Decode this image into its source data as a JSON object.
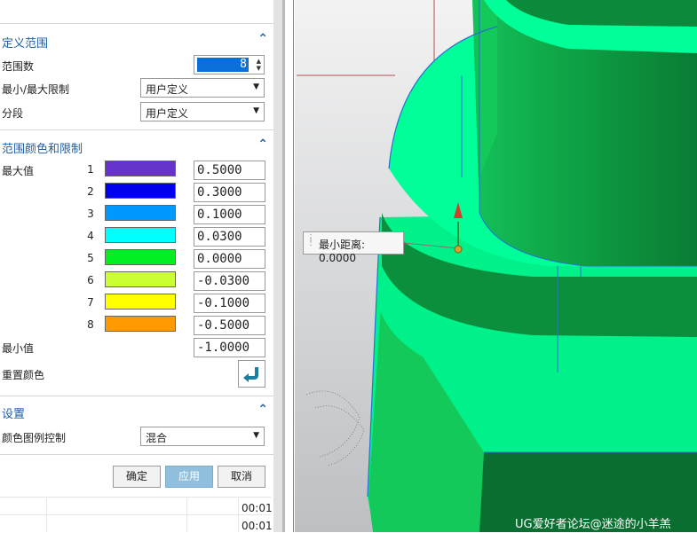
{
  "sections": {
    "range_definition": {
      "title": "定义范围",
      "num_ranges_label": "范围数",
      "num_ranges_value": "8",
      "minmax_label": "最小/最大限制",
      "minmax_value": "用户定义",
      "segment_label": "分段",
      "segment_value": "用户定义"
    },
    "range_colors": {
      "title": "范围颜色和限制",
      "max_label": "最大值",
      "min_label": "最小值",
      "min_value": "-1.0000",
      "reset_label": "重置颜色",
      "rows": [
        {
          "index": "1",
          "color": "#6633cc",
          "value": "0.5000"
        },
        {
          "index": "2",
          "color": "#0000ee",
          "value": "0.3000"
        },
        {
          "index": "3",
          "color": "#0099ff",
          "value": "0.1000"
        },
        {
          "index": "4",
          "color": "#00ffff",
          "value": "0.0300"
        },
        {
          "index": "5",
          "color": "#00ee22",
          "value": "0.0000"
        },
        {
          "index": "6",
          "color": "#ccff33",
          "value": "-0.0300"
        },
        {
          "index": "7",
          "color": "#ffff00",
          "value": "-0.1000"
        },
        {
          "index": "8",
          "color": "#ff9900",
          "value": "-0.5000"
        }
      ]
    },
    "settings": {
      "title": "设置",
      "legend_label": "颜色图例控制",
      "legend_value": "混合"
    }
  },
  "buttons": {
    "ok": "确定",
    "apply": "应用",
    "cancel": "取消"
  },
  "table_rows": [
    {
      "time": "00:01"
    },
    {
      "time": "00:01"
    }
  ],
  "viewport": {
    "callout_text": "最小距离: 0.0000",
    "watermark": "UG爱好者论坛@迷途的小羊羔"
  },
  "icons": {
    "collapse": "chevron-up-icon",
    "reset": "reset-arrow-icon",
    "dropdown": "chevron-down-icon"
  }
}
